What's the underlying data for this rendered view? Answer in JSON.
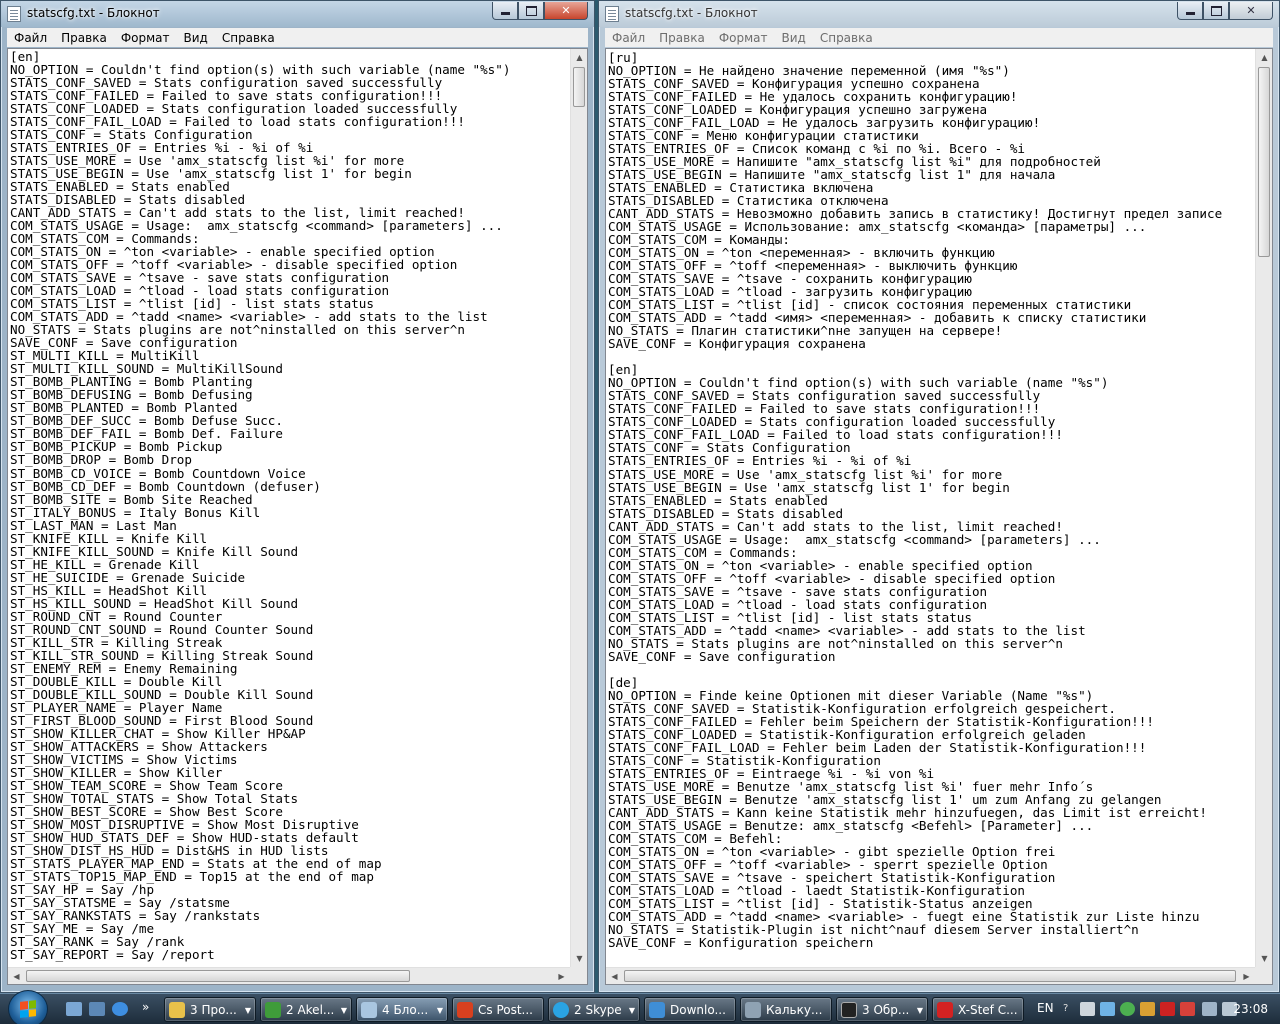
{
  "left_window": {
    "title": "statscfg.txt - Блокнот",
    "menu": [
      "Файл",
      "Правка",
      "Формат",
      "Вид",
      "Справка"
    ],
    "text": "[en]\nNO_OPTION = Couldn't find option(s) with such variable (name \"%s\")\nSTATS_CONF_SAVED = Stats configuration saved successfully\nSTATS_CONF_FAILED = Failed to save stats configuration!!!\nSTATS_CONF_LOADED = Stats configuration loaded successfully\nSTATS_CONF_FAIL_LOAD = Failed to load stats configuration!!!\nSTATS_CONF = Stats Configuration\nSTATS_ENTRIES_OF = Entries %i - %i of %i\nSTATS_USE_MORE = Use 'amx_statscfg list %i' for more\nSTATS_USE_BEGIN = Use 'amx_statscfg list 1' for begin\nSTATS_ENABLED = Stats enabled\nSTATS_DISABLED = Stats disabled\nCANT_ADD_STATS = Can't add stats to the list, limit reached!\nCOM_STATS_USAGE = Usage:  amx_statscfg <command> [parameters] ...\nCOM_STATS_COM = Commands:\nCOM_STATS_ON = ^ton <variable> - enable specified option\nCOM_STATS_OFF = ^toff <variable> - disable specified option\nCOM_STATS_SAVE = ^tsave - save stats configuration\nCOM_STATS_LOAD = ^tload - load stats configuration\nCOM_STATS_LIST = ^tlist [id] - list stats status\nCOM_STATS_ADD = ^tadd <name> <variable> - add stats to the list\nNO_STATS = Stats plugins are not^ninstalled on this server^n\nSAVE_CONF = Save configuration\nST_MULTI_KILL = MultiKill\nST_MULTI_KILL_SOUND = MultiKillSound\nST_BOMB_PLANTING = Bomb Planting\nST_BOMB_DEFUSING = Bomb Defusing\nST_BOMB_PLANTED = Bomb Planted\nST_BOMB_DEF_SUCC = Bomb Defuse Succ.\nST_BOMB_DEF_FAIL = Bomb Def. Failure\nST_BOMB_PICKUP = Bomb Pickup\nST_BOMB_DROP = Bomb Drop\nST_BOMB_CD_VOICE = Bomb Countdown Voice\nST_BOMB_CD_DEF = Bomb Countdown (defuser)\nST_BOMB_SITE = Bomb Site Reached\nST_ITALY_BONUS = Italy Bonus Kill\nST_LAST_MAN = Last Man\nST_KNIFE_KILL = Knife Kill\nST_KNIFE_KILL_SOUND = Knife Kill Sound\nST_HE_KILL = Grenade Kill\nST_HE_SUICIDE = Grenade Suicide\nST_HS_KILL = HeadShot Kill\nST_HS_KILL_SOUND = HeadShot Kill Sound\nST_ROUND_CNT = Round Counter\nST_ROUND_CNT_SOUND = Round Counter Sound\nST_KILL_STR = Killing Streak\nST_KILL_STR_SOUND = Killing Streak Sound\nST_ENEMY_REM = Enemy Remaining\nST_DOUBLE_KILL = Double Kill\nST_DOUBLE_KILL_SOUND = Double Kill Sound\nST_PLAYER_NAME = Player Name\nST_FIRST_BLOOD_SOUND = First Blood Sound\nST_SHOW_KILLER_CHAT = Show Killer HP&AP\nST_SHOW_ATTACKERS = Show Attackers\nST_SHOW_VICTIMS = Show Victims\nST_SHOW_KILLER = Show Killer\nST_SHOW_TEAM_SCORE = Show Team Score\nST_SHOW_TOTAL_STATS = Show Total Stats\nST_SHOW_BEST_SCORE = Show Best Score\nST_SHOW_MOST_DISRUPTIVE = Show Most Disruptive\nST_SHOW_HUD_STATS_DEF = Show HUD-stats default\nST_SHOW_DIST_HS_HUD = Dist&HS in HUD lists\nST_STATS_PLAYER_MAP_END = Stats at the end of map\nST_STATS_TOP15_MAP_END = Top15 at the end of map\nST_SAY_HP = Say /hp\nST_SAY_STATSME = Say /statsme\nST_SAY_RANKSTATS = Say /rankstats\nST_SAY_ME = Say /me\nST_SAY_RANK = Say /rank\nST_SAY_REPORT = Say /report"
  },
  "right_window": {
    "title": "statscfg.txt - Блокнот",
    "menu": [
      "Файл",
      "Правка",
      "Формат",
      "Вид",
      "Справка"
    ],
    "text": "[ru]\nNO_OPTION = Не найдено значение переменной (имя \"%s\")\nSTATS_CONF_SAVED = Конфигурация успешно сохранена\nSTATS_CONF_FAILED = Не удалось сохранить конфигурацию!\nSTATS_CONF_LOADED = Конфигурация успешно загружена\nSTATS_CONF_FAIL_LOAD = Не удалось загрузить конфигурацию!\nSTATS_CONF = Меню конфигурации статистики\nSTATS_ENTRIES_OF = Список команд с %i по %i. Всего - %i\nSTATS_USE_MORE = Напишите \"amx_statscfg list %i\" для подробностей\nSTATS_USE_BEGIN = Напишите \"amx_statscfg list 1\" для начала\nSTATS_ENABLED = Статистика включена\nSTATS_DISABLED = Статистика отключена\nCANT_ADD_STATS = Невозможно добавить запись в статистику! Достигнут предел записе\nCOM_STATS_USAGE = Использование: amx_statscfg <команда> [параметры] ...\nCOM_STATS_COM = Команды:\nCOM_STATS_ON = ^ton <переменная> - включить функцию\nCOM_STATS_OFF = ^toff <переменная> - выключить функцию\nCOM_STATS_SAVE = ^tsave - сохранить конфигурацию\nCOM_STATS_LOAD = ^tload - загрузить конфигурацию\nCOM_STATS_LIST = ^tlist [id] - список состояния переменных статистики\nCOM_STATS_ADD = ^tadd <имя> <переменная> - добавить к списку статистики\nNO_STATS = Плагин статистики^nне запущен на сервере!\nSAVE_CONF = Конфигурация сохранена\n\n[en]\nNO_OPTION = Couldn't find option(s) with such variable (name \"%s\")\nSTATS_CONF_SAVED = Stats configuration saved successfully\nSTATS_CONF_FAILED = Failed to save stats configuration!!!\nSTATS_CONF_LOADED = Stats configuration loaded successfully\nSTATS_CONF_FAIL_LOAD = Failed to load stats configuration!!!\nSTATS_CONF = Stats Configuration\nSTATS_ENTRIES_OF = Entries %i - %i of %i\nSTATS_USE_MORE = Use 'amx_statscfg list %i' for more\nSTATS_USE_BEGIN = Use 'amx_statscfg list 1' for begin\nSTATS_ENABLED = Stats enabled\nSTATS_DISABLED = Stats disabled\nCANT_ADD_STATS = Can't add stats to the list, limit reached!\nCOM_STATS_USAGE = Usage:  amx_statscfg <command> [parameters] ...\nCOM_STATS_COM = Commands:\nCOM_STATS_ON = ^ton <variable> - enable specified option\nCOM_STATS_OFF = ^toff <variable> - disable specified option\nCOM_STATS_SAVE = ^tsave - save stats configuration\nCOM_STATS_LOAD = ^tload - load stats configuration\nCOM_STATS_LIST = ^tlist [id] - list stats status\nCOM_STATS_ADD = ^tadd <name> <variable> - add stats to the list\nNO_STATS = Stats plugins are not^ninstalled on this server^n\nSAVE_CONF = Save configuration\n\n[de]\nNO_OPTION = Finde keine Optionen mit dieser Variable (Name \"%s\")\nSTATS_CONF_SAVED = Statistik-Konfiguration erfolgreich gespeichert.\nSTATS_CONF_FAILED = Fehler beim Speichern der Statistik-Konfiguration!!!\nSTATS_CONF_LOADED = Statistik-Konfiguration erfolgreich geladen\nSTATS_CONF_FAIL_LOAD = Fehler beim Laden der Statistik-Konfiguration!!!\nSTATS_CONF = Statistik-Konfiguration\nSTATS_ENTRIES_OF = Eintraege %i - %i von %i\nSTATS_USE_MORE = Benutze 'amx_statscfg list %i' fuer mehr Info´s\nSTATS_USE_BEGIN = Benutze 'amx_statscfg list 1' um zum Anfang zu gelangen\nCANT_ADD_STATS = Kann keine Statistik mehr hinzufuegen, das Limit ist erreicht!\nCOM_STATS_USAGE = Benutze: amx_statscfg <Befehl> [Parameter] ...\nCOM_STATS_COM = Befehl:\nCOM_STATS_ON = ^ton <variable> - gibt spezielle Option frei\nCOM_STATS_OFF = ^toff <variable> - sperrt spezielle Option\nCOM_STATS_SAVE = ^tsave - speichert Statistik-Konfiguration\nCOM_STATS_LOAD = ^tload - laedt Statistik-Konfiguration\nCOM_STATS_LIST = ^tlist [id] - Statistik-Status anzeigen\nCOM_STATS_ADD = ^tadd <name> <variable> - fuegt eine Statistik zur Liste hinzu\nNO_STATS = Statistik-Plugin ist nicht^nauf diesem Server installiert^n\nSAVE_CONF = Konfiguration speichern"
  },
  "taskbar": {
    "more": "»",
    "buttons": [
      {
        "label": "3 Про...",
        "color": "#e8c14a"
      },
      {
        "label": "2 Akel...",
        "color": "#3f9c3a"
      },
      {
        "label": "4 Бло...",
        "color": "#a9c6e0"
      },
      {
        "label": "Cs Post...",
        "color": "#d8401f"
      },
      {
        "label": "2 Skype",
        "color": "#2aa3e3"
      },
      {
        "label": "Downlo...",
        "color": "#3f8ed6"
      },
      {
        "label": "Кальку...",
        "color": "#8fa2b3"
      },
      {
        "label": "3 Обр...",
        "color": "#222222"
      },
      {
        "label": "X-Stef C...",
        "color": "#d32222"
      }
    ],
    "language": "EN",
    "clock": "23:08"
  }
}
